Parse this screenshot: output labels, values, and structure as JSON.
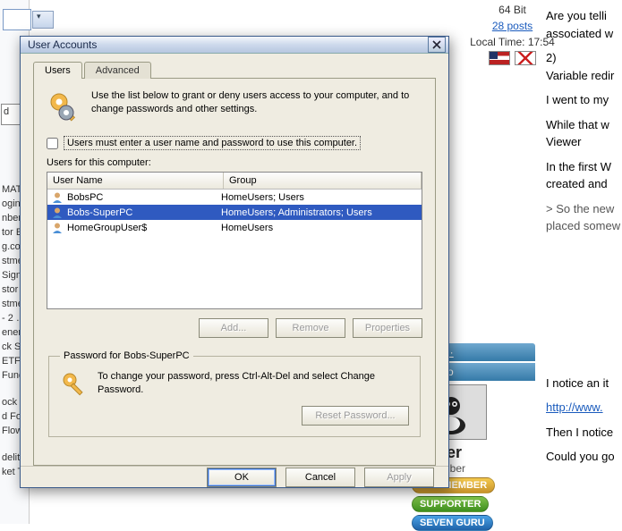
{
  "background": {
    "left_items": [
      "",
      "",
      "",
      "",
      "",
      "",
      "",
      "",
      "",
      "MATI…",
      "ogin - …",
      "nber …",
      "tor E…",
      "g.com…",
      "stme…",
      "Signals",
      "stor G…",
      "stme…",
      "- 2 …",
      "ener -…",
      "ck Scr…",
      "ETFs",
      "Fund…",
      "",
      "ock M…",
      "d Foll…",
      "Flow …",
      "",
      "delity",
      "ket Ti…"
    ],
    "textfrag": "d",
    "meta_bits": "64 Bit",
    "meta_posts": "28 posts",
    "meta_time": "Local Time: 17:54",
    "paras": [
      "Are you telli",
      "associated w",
      "2)",
      "Variable redir",
      "I went to my",
      "While that w",
      "Viewer",
      "In the first W",
      "created and",
      "> So the new",
      "placed somew"
    ],
    "lower": [
      "I notice an it",
      "http://www.",
      "Then I notice",
      "Could you go"
    ],
    "specs_link": "Specs ·",
    "ago_bar": "·es Ago",
    "username": "lender",
    "rank": "or Member",
    "pill_gold": "OLD MEMBER",
    "pill_green": "SUPPORTER",
    "pill_blue": "SEVEN GURU"
  },
  "dialog": {
    "title": "User Accounts",
    "tabs": {
      "users": "Users",
      "advanced": "Advanced"
    },
    "intro": "Use the list below to grant or deny users access to your computer, and to change passwords and other settings.",
    "checkbox_label": "Users must enter a user name and password to use this computer.",
    "list_caption": "Users for this computer:",
    "columns": {
      "user": "User Name",
      "group": "Group"
    },
    "rows": [
      {
        "user": "BobsPC",
        "group": "HomeUsers; Users",
        "selected": false
      },
      {
        "user": "Bobs-SuperPC",
        "group": "HomeUsers; Administrators; Users",
        "selected": true
      },
      {
        "user": "HomeGroupUser$",
        "group": "HomeUsers",
        "selected": false
      }
    ],
    "buttons": {
      "add": "Add...",
      "remove": "Remove",
      "properties": "Properties"
    },
    "password_group": {
      "legend": "Password for Bobs-SuperPC",
      "text": "To change your password, press Ctrl-Alt-Del and select Change Password.",
      "reset": "Reset Password..."
    },
    "footer": {
      "ok": "OK",
      "cancel": "Cancel",
      "apply": "Apply"
    }
  }
}
